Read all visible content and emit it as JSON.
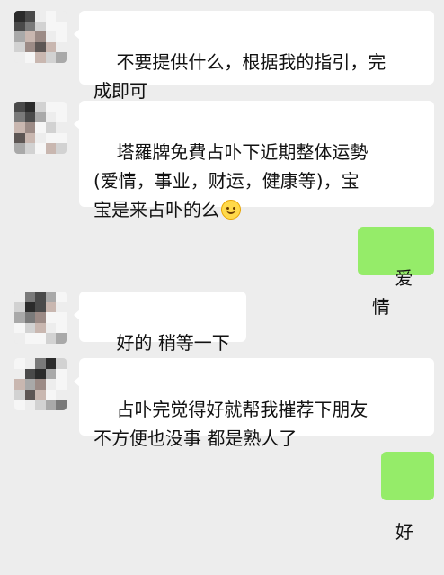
{
  "messages": [
    {
      "side": "left",
      "text": "不要提供什么，根据我的指引，完\n成即可"
    },
    {
      "side": "left",
      "text": "塔羅牌免費占卟下近期整体运勢\n(爱情，事业，财运，健康等)，宝\n宝是来占卟的么",
      "emoji": "smiling-face-emoji"
    },
    {
      "side": "right",
      "text": "爱情"
    },
    {
      "side": "left",
      "text": "好的 稍等一下"
    },
    {
      "side": "left",
      "text": "占卟完觉得好就帮我摧荐下朋友\n不方便也没事 都是熟人了"
    },
    {
      "side": "right",
      "text": "好"
    }
  ],
  "colors": {
    "background": "#ededed",
    "incoming_bubble": "#ffffff",
    "outgoing_bubble": "#95ec69"
  }
}
